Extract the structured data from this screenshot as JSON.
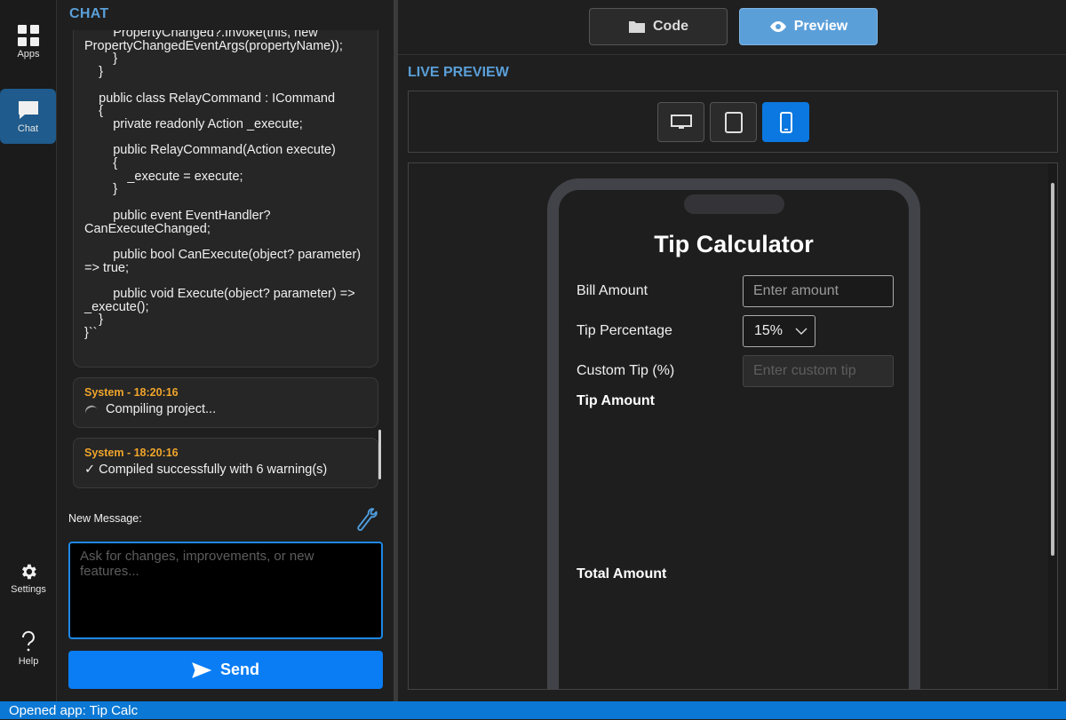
{
  "nav": {
    "apps_label": "Apps",
    "chat_label": "Chat",
    "settings_label": "Settings",
    "help_label": "Help"
  },
  "chat": {
    "title": "CHAT",
    "code_snippet": "        PropertyChanged?.Invoke(this, new PropertyChangedEventArgs(propertyName));\n        }\n    }\n\n    public class RelayCommand : ICommand\n    {\n        private readonly Action _execute;\n\n        public RelayCommand(Action execute)\n        {\n            _execute = execute;\n        }\n\n        public event EventHandler? CanExecuteChanged;\n\n        public bool CanExecute(object? parameter) => true;\n\n        public void Execute(object? parameter) => _execute();\n    }\n}``",
    "messages": [
      {
        "sender": "System - 18:20:16",
        "text": "Compiling project...",
        "icon": "spinner-icon"
      },
      {
        "sender": "System - 18:20:16",
        "text": "✓ Compiled successfully with 6 warning(s)"
      }
    ],
    "new_message_label": "New Message:",
    "input_placeholder": "Ask for changes, improvements, or new features...",
    "send_label": "Send"
  },
  "toolbar": {
    "code_label": "Code",
    "preview_label": "Preview"
  },
  "preview": {
    "title": "LIVE PREVIEW",
    "devices": [
      "desktop-icon",
      "tablet-icon",
      "phone-icon"
    ],
    "active_device": "phone"
  },
  "app": {
    "title": "Tip Calculator",
    "bill_label": "Bill Amount",
    "bill_placeholder": "Enter amount",
    "tip_label": "Tip Percentage",
    "tip_value": "15%",
    "custom_label": "Custom Tip (%)",
    "custom_placeholder": "Enter custom tip",
    "tip_amount_label": "Tip Amount",
    "total_amount_label": "Total Amount"
  },
  "status": {
    "text": "Opened app: Tip Calc"
  },
  "colors": {
    "accent": "#5a9fd8",
    "send": "#0a7df5",
    "system_sender": "#f0a52a",
    "status_bar": "#0a78d4"
  }
}
